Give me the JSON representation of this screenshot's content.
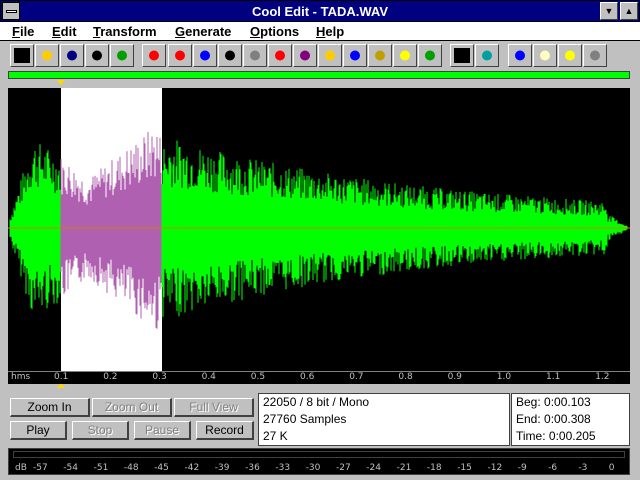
{
  "window": {
    "title": "Cool Edit - TADA.WAV",
    "minimize_glyph": "▼",
    "maximize_glyph": "▲"
  },
  "menu": [
    "File",
    "Edit",
    "Transform",
    "Generate",
    "Options",
    "Help"
  ],
  "toolbar": {
    "icons": [
      "pencil-icon",
      "open-folder-icon",
      "save-icon",
      "save-as-icon",
      "mix-icon",
      "reverse-icon",
      "invert-icon",
      "music-note-icon",
      "record-dot-icon",
      "envelope-icon",
      "fade-icon",
      "filter-icon",
      "stretch-icon",
      "echo-icon",
      "noise-icon",
      "brightness-icon",
      "spectrum-icon",
      "play-line-icon",
      "spectral-icon",
      "refresh-icon",
      "notes-icon",
      "help-icon",
      "settings-icon"
    ]
  },
  "ruler": {
    "unit": "hms",
    "labels": [
      "0.1",
      "0.2",
      "0.3",
      "0.4",
      "0.5",
      "0.6",
      "0.7",
      "0.8",
      "0.9",
      "1.0",
      "1.1",
      "1.2"
    ]
  },
  "selection": {
    "start_seconds": 0.103,
    "end_seconds": 0.308
  },
  "buttons": {
    "zoom_in": "Zoom In",
    "zoom_out": "Zoom Out",
    "full_view": "Full View",
    "play": "Play",
    "stop": "Stop",
    "pause": "Pause",
    "record": "Record"
  },
  "file_info": {
    "format": "22050 / 8 bit / Mono",
    "samples": "27760 Samples",
    "size": "27 K"
  },
  "range_info": {
    "beg": "Beg:  0:00.103",
    "end": "End:  0:00.308",
    "time": "Time:  0:00.205"
  },
  "meter": {
    "unit": "dB",
    "labels": [
      "-57",
      "-54",
      "-51",
      "-48",
      "-45",
      "-42",
      "-39",
      "-36",
      "-33",
      "-30",
      "-27",
      "-24",
      "-21",
      "-18",
      "-15",
      "-12",
      "-9",
      "-6",
      "-3",
      "0"
    ]
  },
  "colors": {
    "waveform": "#00ff00",
    "selected_waveform": "#b060b0",
    "selection_bg": "#ffffff",
    "title_bar": "#000080"
  }
}
